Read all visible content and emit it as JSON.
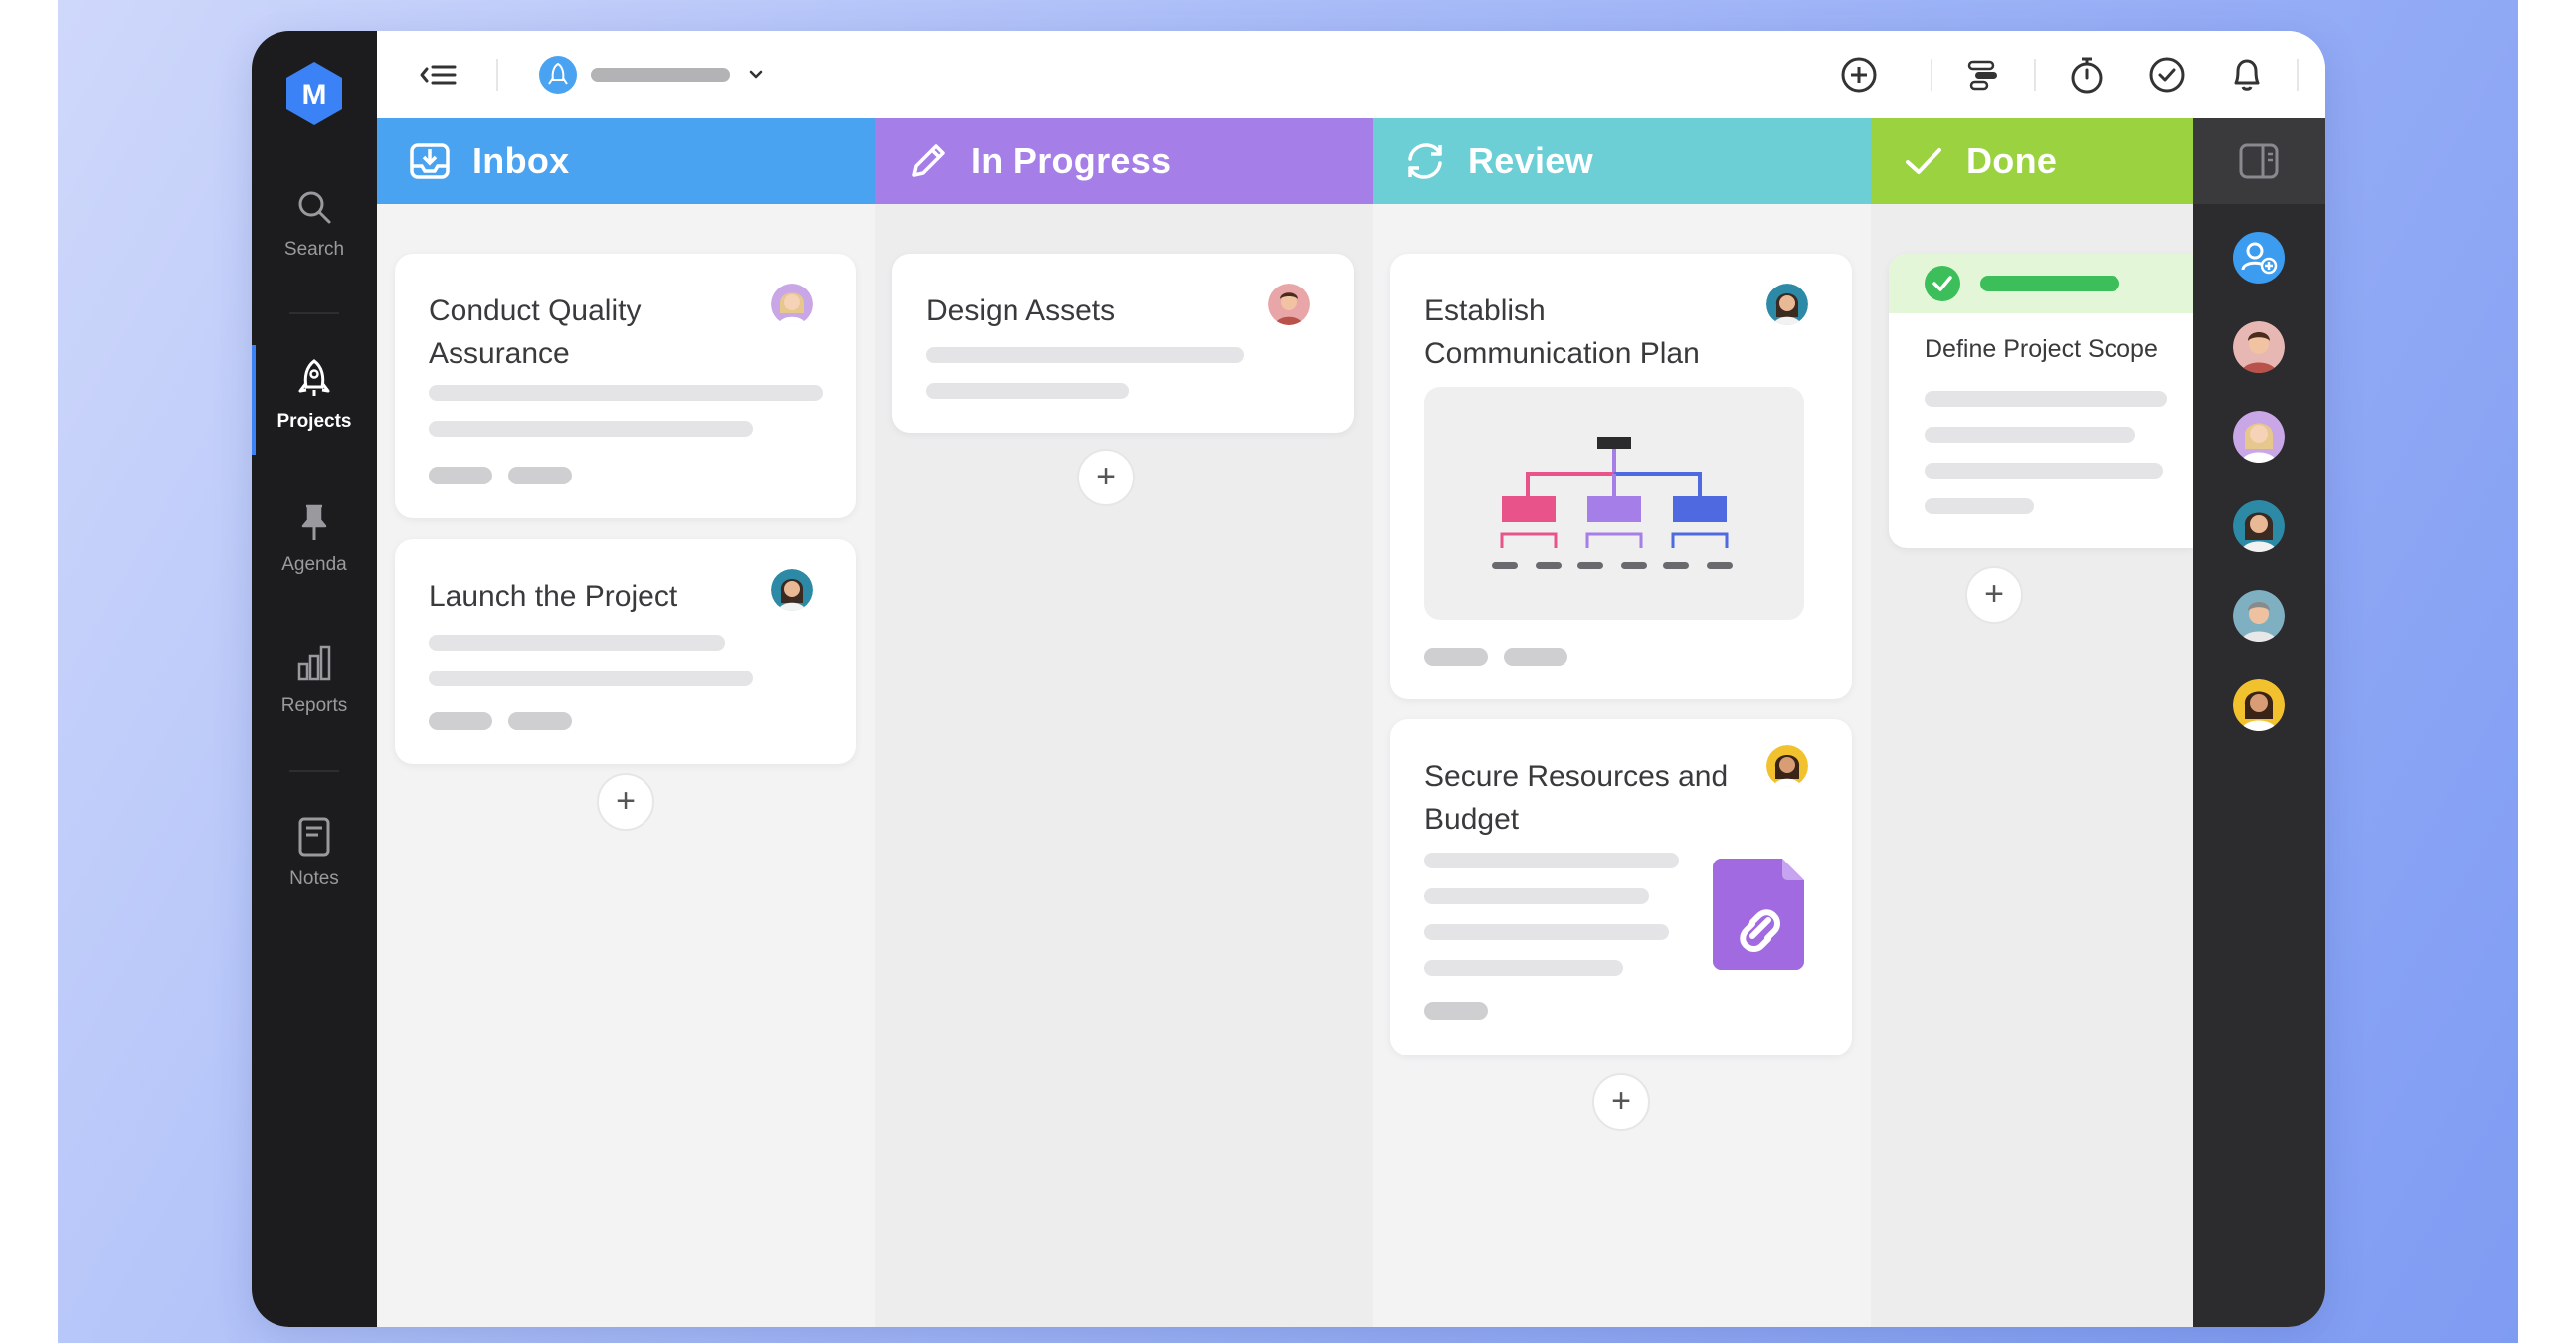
{
  "app": {
    "logo_letter": "M",
    "brand_color": "#3b82f6"
  },
  "sidebar": {
    "items": [
      {
        "label": "Search",
        "icon": "search-icon"
      },
      {
        "label": "Projects",
        "icon": "rocket-icon",
        "active": true
      },
      {
        "label": "Agenda",
        "icon": "pin-icon"
      },
      {
        "label": "Reports",
        "icon": "bar-chart-icon"
      },
      {
        "label": "Notes",
        "icon": "note-icon"
      }
    ]
  },
  "topbar": {
    "icons": [
      "collapse-menu-icon",
      "project-icon",
      "chevron-down-icon",
      "add-icon",
      "gantt-icon",
      "timer-icon",
      "check-circle-icon",
      "bell-icon",
      "search-icon",
      "help-icon",
      "user-avatar"
    ]
  },
  "columns": [
    {
      "title": "Inbox",
      "color": "#4aa3f0",
      "icon": "inbox-icon",
      "cards": [
        {
          "title_line1": "Conduct Quality",
          "title_line2": "Assurance"
        },
        {
          "title_line1": "Launch the Project",
          "title_line2": ""
        }
      ]
    },
    {
      "title": "In Progress",
      "color": "#a57ee8",
      "icon": "pencil-icon",
      "cards": [
        {
          "title_line1": "Design Assets",
          "title_line2": ""
        }
      ]
    },
    {
      "title": "Review",
      "color": "#6dcfd6",
      "icon": "refresh-icon",
      "cards": [
        {
          "title_line1": "Establish",
          "title_line2": "Communication Plan"
        },
        {
          "title_line1": "Secure Resources and",
          "title_line2": "Budget"
        }
      ]
    },
    {
      "title": "Done",
      "color": "#9bd23f",
      "icon": "check-icon",
      "cards": [
        {
          "title_line1": "Define Project Scope",
          "title_line2": ""
        }
      ]
    }
  ],
  "add_label": "+"
}
